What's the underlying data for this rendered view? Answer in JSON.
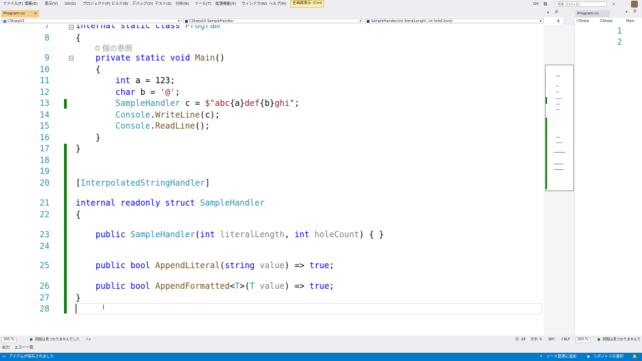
{
  "menu": {
    "items": [
      "ファイル(F)",
      "編集(E)",
      "表示(V)",
      "Git(G)",
      "プロジェクト(P)",
      "ビルド(B)",
      "デバッグ(D)",
      "テスト(S)",
      "分析(N)",
      "ツール(T)",
      "拡張機能(X)",
      "ウィンドウ(W)",
      "ヘルプ(H)"
    ],
    "highlighted": "全画面表示 (Ctrl)",
    "search_placeholder": "検索 (Ctrl+Q)",
    "git_badge": "Git"
  },
  "tabs": {
    "active": "Program.cs"
  },
  "navbar": {
    "project": "CSharp10",
    "type": "CSharp10.SampleHandler",
    "member": "SampleHandler(int literalLength, int holeCount)"
  },
  "editor": {
    "line_numbers": [
      "7",
      "8",
      "9",
      "10",
      "11",
      "12",
      "13",
      "14",
      "15",
      "16",
      "17",
      "18",
      "19",
      "20",
      "21",
      "22",
      "23",
      "24",
      "25",
      "26",
      "27",
      "28"
    ],
    "ref_count": "0 個の参照"
  },
  "right_pane": {
    "tab": "Program.cs",
    "nav1": "CSharp",
    "nav2": "CSharp",
    "nav3": "Main",
    "line1": "1",
    "line2": "2"
  },
  "status_editor": {
    "zoom": "200 %",
    "issues": "問題は見つかりませんでした",
    "position": "行: 28",
    "column": "文字: 5",
    "spc": "SPC",
    "crlf": "CRLF"
  },
  "right_status": {
    "zoom": "200 %",
    "issues": "問題は見つかりませんでした"
  },
  "output_bar": {
    "output": "出力",
    "errors": "エラー一覧"
  },
  "app_status": {
    "left": "アイテムが保存されました",
    "source_control": "ソース管理に追加",
    "repo": "リポジトリの選択"
  }
}
